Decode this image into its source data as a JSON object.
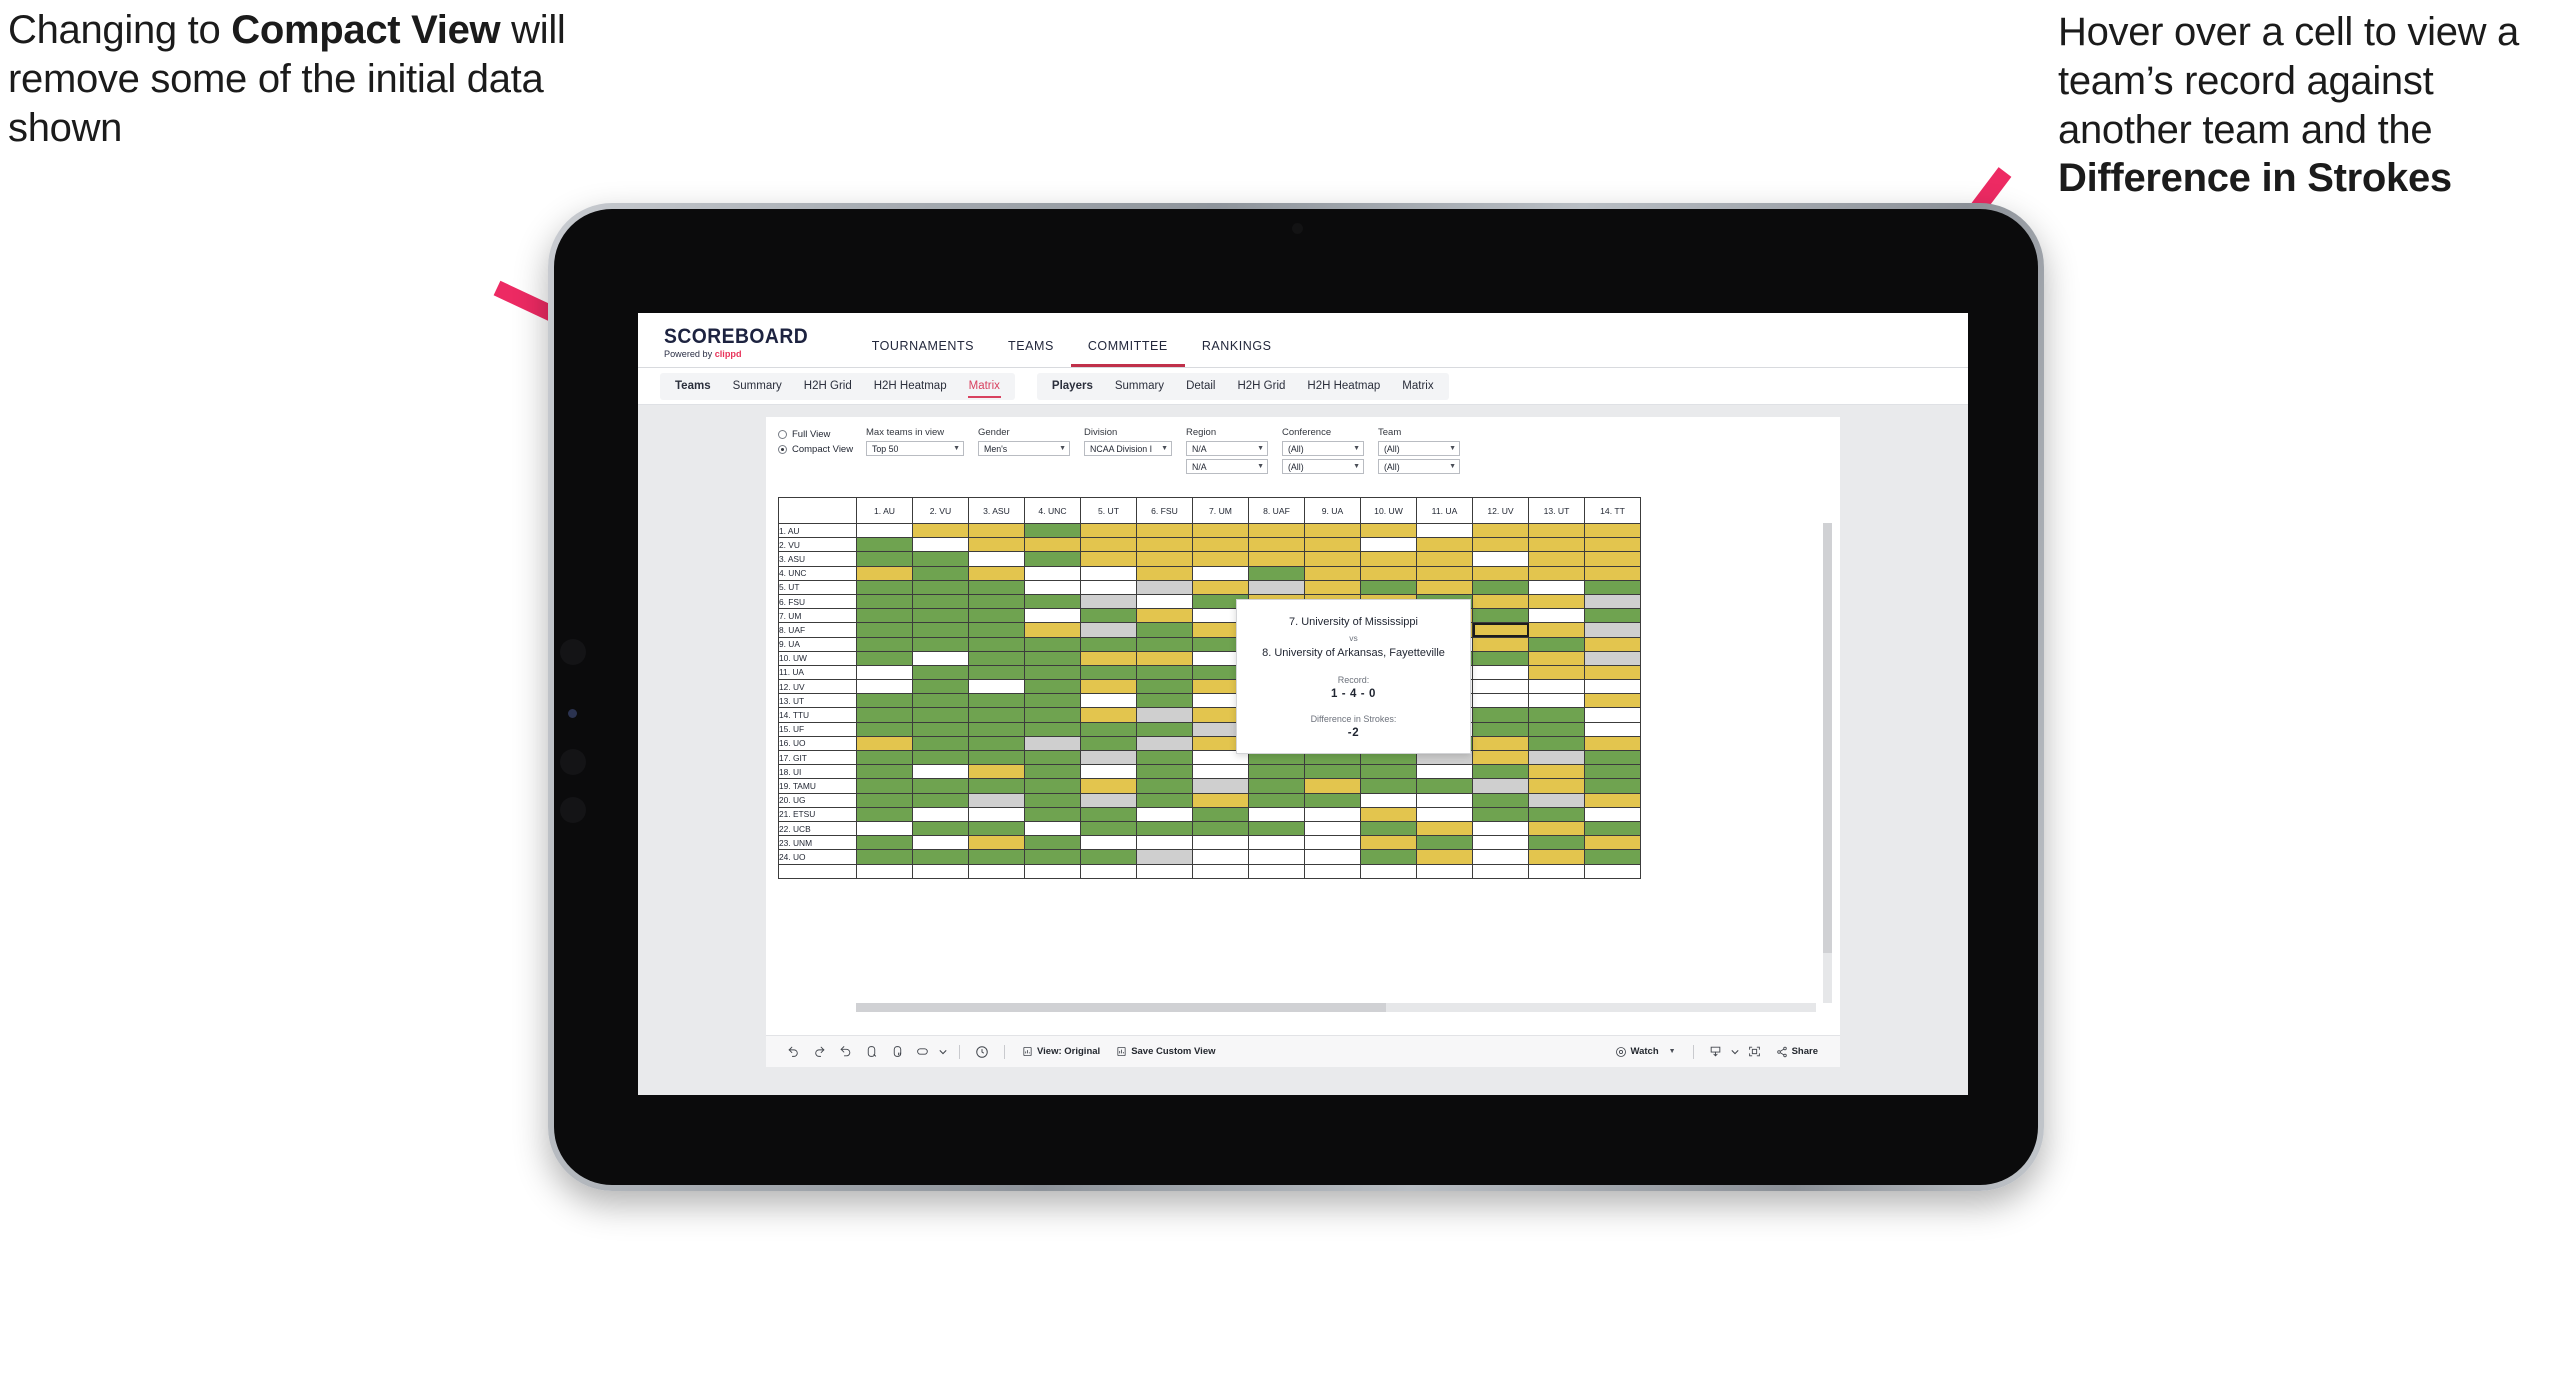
{
  "annotations": {
    "left": {
      "pre": "Changing to ",
      "bold": "Compact View",
      "post": " will remove some of the initial data shown"
    },
    "right": {
      "pre": "Hover over a cell to view a team’s record against another team and the ",
      "bold": "Difference in Strokes",
      "post": ""
    },
    "arrow_color": "#ED2A63"
  },
  "app": {
    "logo": {
      "main": "SCOREBOARD",
      "powered": "Powered by ",
      "brand": "clippd"
    },
    "topnav": [
      {
        "label": "TOURNAMENTS",
        "active": false
      },
      {
        "label": "TEAMS",
        "active": false
      },
      {
        "label": "COMMITTEE",
        "active": true
      },
      {
        "label": "RANKINGS",
        "active": false
      }
    ],
    "subnav": {
      "teams_group": [
        {
          "label": "Teams",
          "type": "head"
        },
        {
          "label": "Summary",
          "type": "item"
        },
        {
          "label": "H2H Grid",
          "type": "item"
        },
        {
          "label": "H2H Heatmap",
          "type": "item"
        },
        {
          "label": "Matrix",
          "type": "selected"
        }
      ],
      "players_group": [
        {
          "label": "Players",
          "type": "head"
        },
        {
          "label": "Summary",
          "type": "item"
        },
        {
          "label": "Detail",
          "type": "item"
        },
        {
          "label": "H2H Grid",
          "type": "item"
        },
        {
          "label": "H2H Heatmap",
          "type": "item"
        },
        {
          "label": "Matrix",
          "type": "item"
        }
      ]
    },
    "filters": {
      "view_mode": {
        "options": [
          "Full View",
          "Compact View"
        ],
        "selected": "Compact View"
      },
      "max_teams": {
        "label": "Max teams in view",
        "value": "Top 50"
      },
      "gender": {
        "label": "Gender",
        "value": "Men's"
      },
      "division": {
        "label": "Division",
        "value": "NCAA Division I"
      },
      "region": {
        "label": "Region",
        "value1": "N/A",
        "value2": "N/A"
      },
      "conference": {
        "label": "Conference",
        "value1": "(All)",
        "value2": "(All)"
      },
      "team": {
        "label": "Team",
        "value1": "(All)",
        "value2": "(All)"
      }
    },
    "tooltip": {
      "team_a": "7. University of Mississippi",
      "vs": "vs",
      "team_b": "8. University of Arkansas, Fayetteville",
      "record_label": "Record:",
      "record_value": "1 - 4 - 0",
      "diff_label": "Difference in Strokes:",
      "diff_value": "-2"
    },
    "toolbar": {
      "view_original": "View: Original",
      "save_custom_view": "Save Custom View",
      "watch": "Watch",
      "share": "Share"
    }
  },
  "chart_data": {
    "type": "heatmap",
    "title": "Head-to-Head Team Matrix",
    "legend": {
      "green": "#6fa350",
      "yellow": "#e3c54e",
      "white": "#ffffff",
      "grey": "#cfcfcf"
    },
    "columns": [
      "1. AU",
      "2. VU",
      "3. ASU",
      "4. UNC",
      "5. UT",
      "6. FSU",
      "7. UM",
      "8. UAF",
      "9. UA",
      "10. UW",
      "11. UA",
      "12. UV",
      "13. UT",
      "14. TT"
    ],
    "rows": [
      "1. AU",
      "2. VU",
      "3. ASU",
      "4. UNC",
      "5. UT",
      "6. FSU",
      "7. UM",
      "8. UAF",
      "9. UA",
      "10. UW",
      "11. UA",
      "12. UV",
      "13. UT",
      "14. TTU",
      "15. UF",
      "16. UO",
      "17. GIT",
      "18. UI",
      "19. TAMU",
      "20. UG",
      "21. ETSU",
      "22. UCB",
      "23. UNM",
      "24. UO"
    ],
    "cells": [
      [
        "w",
        "y",
        "y",
        "g",
        "y",
        "y",
        "y",
        "y",
        "y",
        "y",
        "w",
        "y",
        "y",
        "y"
      ],
      [
        "g",
        "w",
        "y",
        "y",
        "y",
        "y",
        "y",
        "y",
        "y",
        "w",
        "y",
        "y",
        "y",
        "y"
      ],
      [
        "g",
        "g",
        "w",
        "g",
        "y",
        "y",
        "y",
        "y",
        "y",
        "y",
        "y",
        "w",
        "y",
        "y"
      ],
      [
        "y",
        "g",
        "y",
        "w",
        "w",
        "y",
        "w",
        "g",
        "y",
        "y",
        "y",
        "y",
        "y",
        "y"
      ],
      [
        "g",
        "g",
        "g",
        "w",
        "w",
        "a",
        "y",
        "a",
        "y",
        "g",
        "y",
        "g",
        "w",
        "g"
      ],
      [
        "g",
        "g",
        "g",
        "g",
        "a",
        "w",
        "g",
        "y",
        "y",
        "y",
        "g",
        "y",
        "y",
        "a"
      ],
      [
        "g",
        "g",
        "g",
        "w",
        "g",
        "y",
        "w",
        "g",
        "y",
        "w",
        "y",
        "g",
        "w",
        "g"
      ],
      [
        "g",
        "g",
        "g",
        "y",
        "a",
        "g",
        "y",
        "w",
        "y",
        "y",
        "y",
        "y",
        "y",
        "a"
      ],
      [
        "g",
        "g",
        "g",
        "g",
        "g",
        "g",
        "g",
        "w",
        "w",
        "g",
        "w",
        "y",
        "g",
        "y"
      ],
      [
        "g",
        "w",
        "g",
        "g",
        "y",
        "y",
        "w",
        "w",
        "g",
        "w",
        "g",
        "g",
        "y",
        "a"
      ],
      [
        "w",
        "g",
        "g",
        "g",
        "g",
        "g",
        "g",
        "g",
        "w",
        "g",
        "w",
        "w",
        "y",
        "y"
      ],
      [
        "w",
        "g",
        "w",
        "g",
        "y",
        "g",
        "y",
        "g",
        "g",
        "g",
        "w",
        "w",
        "w",
        "w"
      ],
      [
        "g",
        "g",
        "g",
        "g",
        "w",
        "g",
        "w",
        "g",
        "g",
        "g",
        "w",
        "w",
        "w",
        "y"
      ],
      [
        "g",
        "g",
        "g",
        "g",
        "y",
        "a",
        "y",
        "g",
        "g",
        "g",
        "w",
        "g",
        "g",
        "w"
      ],
      [
        "g",
        "g",
        "g",
        "g",
        "g",
        "g",
        "a",
        "g",
        "g",
        "g",
        "w",
        "g",
        "g",
        "w"
      ],
      [
        "y",
        "g",
        "g",
        "a",
        "g",
        "a",
        "y",
        "g",
        "g",
        "g",
        "g",
        "y",
        "g",
        "y"
      ],
      [
        "g",
        "g",
        "g",
        "g",
        "a",
        "g",
        "w",
        "g",
        "g",
        "g",
        "a",
        "y",
        "a",
        "g"
      ],
      [
        "g",
        "w",
        "y",
        "g",
        "w",
        "g",
        "w",
        "g",
        "g",
        "g",
        "w",
        "g",
        "y",
        "g"
      ],
      [
        "g",
        "g",
        "g",
        "g",
        "y",
        "g",
        "a",
        "g",
        "y",
        "g",
        "g",
        "a",
        "y",
        "g"
      ],
      [
        "g",
        "g",
        "a",
        "g",
        "a",
        "g",
        "y",
        "g",
        "g",
        "w",
        "w",
        "g",
        "a",
        "y"
      ],
      [
        "g",
        "w",
        "w",
        "g",
        "g",
        "w",
        "g",
        "w",
        "w",
        "y",
        "w",
        "g",
        "g",
        "w"
      ],
      [
        "w",
        "g",
        "g",
        "w",
        "g",
        "g",
        "g",
        "g",
        "w",
        "g",
        "y",
        "w",
        "y",
        "g"
      ],
      [
        "g",
        "w",
        "y",
        "g",
        "w",
        "w",
        "w",
        "w",
        "w",
        "y",
        "g",
        "w",
        "g",
        "y"
      ],
      [
        "g",
        "g",
        "g",
        "g",
        "g",
        "a",
        "w",
        "w",
        "w",
        "g",
        "y",
        "w",
        "y",
        "g"
      ]
    ],
    "highlight": {
      "row": 7,
      "col": 11
    }
  }
}
